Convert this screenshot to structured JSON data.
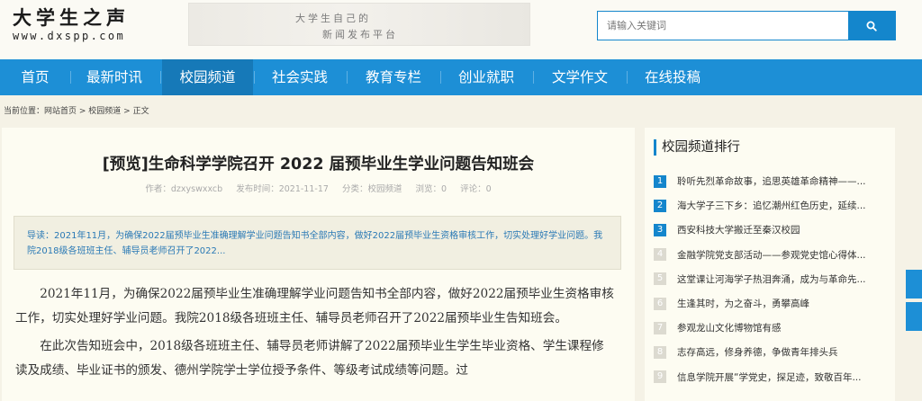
{
  "site": {
    "logo_cn": "大学生之声",
    "logo_en": "www.dxspp.com",
    "banner_line1": "大学生自己的",
    "banner_line2": "新闻发布平台"
  },
  "search": {
    "placeholder": "请输入关键词",
    "icon": "search-icon"
  },
  "nav": {
    "items": [
      "首页",
      "最新时讯",
      "校园频道",
      "社会实践",
      "教育专栏",
      "创业就职",
      "文学作文",
      "在线投稿"
    ],
    "active_index": 2
  },
  "breadcrumb": {
    "prefix": "当前位置：",
    "home": "网站首页",
    "sep": " > ",
    "channel": "校园频道",
    "current": "正文"
  },
  "article": {
    "title": "[预览]生命科学学院召开 2022 届预毕业生学业问题告知班会",
    "author": "作者：dzxyswxxcb",
    "date": "发布时间：2021-11-17",
    "category": "分类：校园频道",
    "views": "浏览：0",
    "comments": "评论：0",
    "summary": "导读：2021年11月，为确保2022届预毕业生准确理解学业问题告知书全部内容，做好2022届预毕业生资格审核工作，切实处理好学业问题。我院2018级各班班主任、辅导员老师召开了2022...",
    "para1": "2021年11月，为确保2022届预毕业生准确理解学业问题告知书全部内容，做好2022届预毕业生资格审核工作，切实处理好学业问题。我院2018级各班班主任、辅导员老师召开了2022届预毕业生告知班会。",
    "para2": "在此次告知班会中，2018级各班班主任、辅导员老师讲解了2022届预毕业生学生毕业资格、学生课程修读及成绩、毕业证书的颁发、德州学院学士学位授予条件、等级考试成绩等问题。过"
  },
  "sidebar": {
    "title": "校园频道排行",
    "items": [
      {
        "num": "1",
        "text": "聆听先烈革命故事，追思英雄革命精神——..."
      },
      {
        "num": "2",
        "text": "海大学子三下乡：追忆潮州红色历史，延续..."
      },
      {
        "num": "3",
        "text": "西安科技大学搬迁至秦汉校园"
      },
      {
        "num": "4",
        "text": "金融学院党支部活动——参观党史馆心得体..."
      },
      {
        "num": "5",
        "text": "这堂课让河海学子热泪奔涌，成为与革命先..."
      },
      {
        "num": "6",
        "text": "生逢其时，为之奋斗，勇攀高峰"
      },
      {
        "num": "7",
        "text": "参观龙山文化博物馆有感"
      },
      {
        "num": "8",
        "text": "志存高远，修身养德，争做青年排头兵"
      },
      {
        "num": "9",
        "text": "信息学院开展“学党史，探足迹，致敬百年..."
      }
    ]
  },
  "colors": {
    "primary": "#1d8fd6",
    "nav_active": "#1679b8",
    "summary_text": "#2a79b5",
    "page_bg": "#f5f2e6"
  }
}
